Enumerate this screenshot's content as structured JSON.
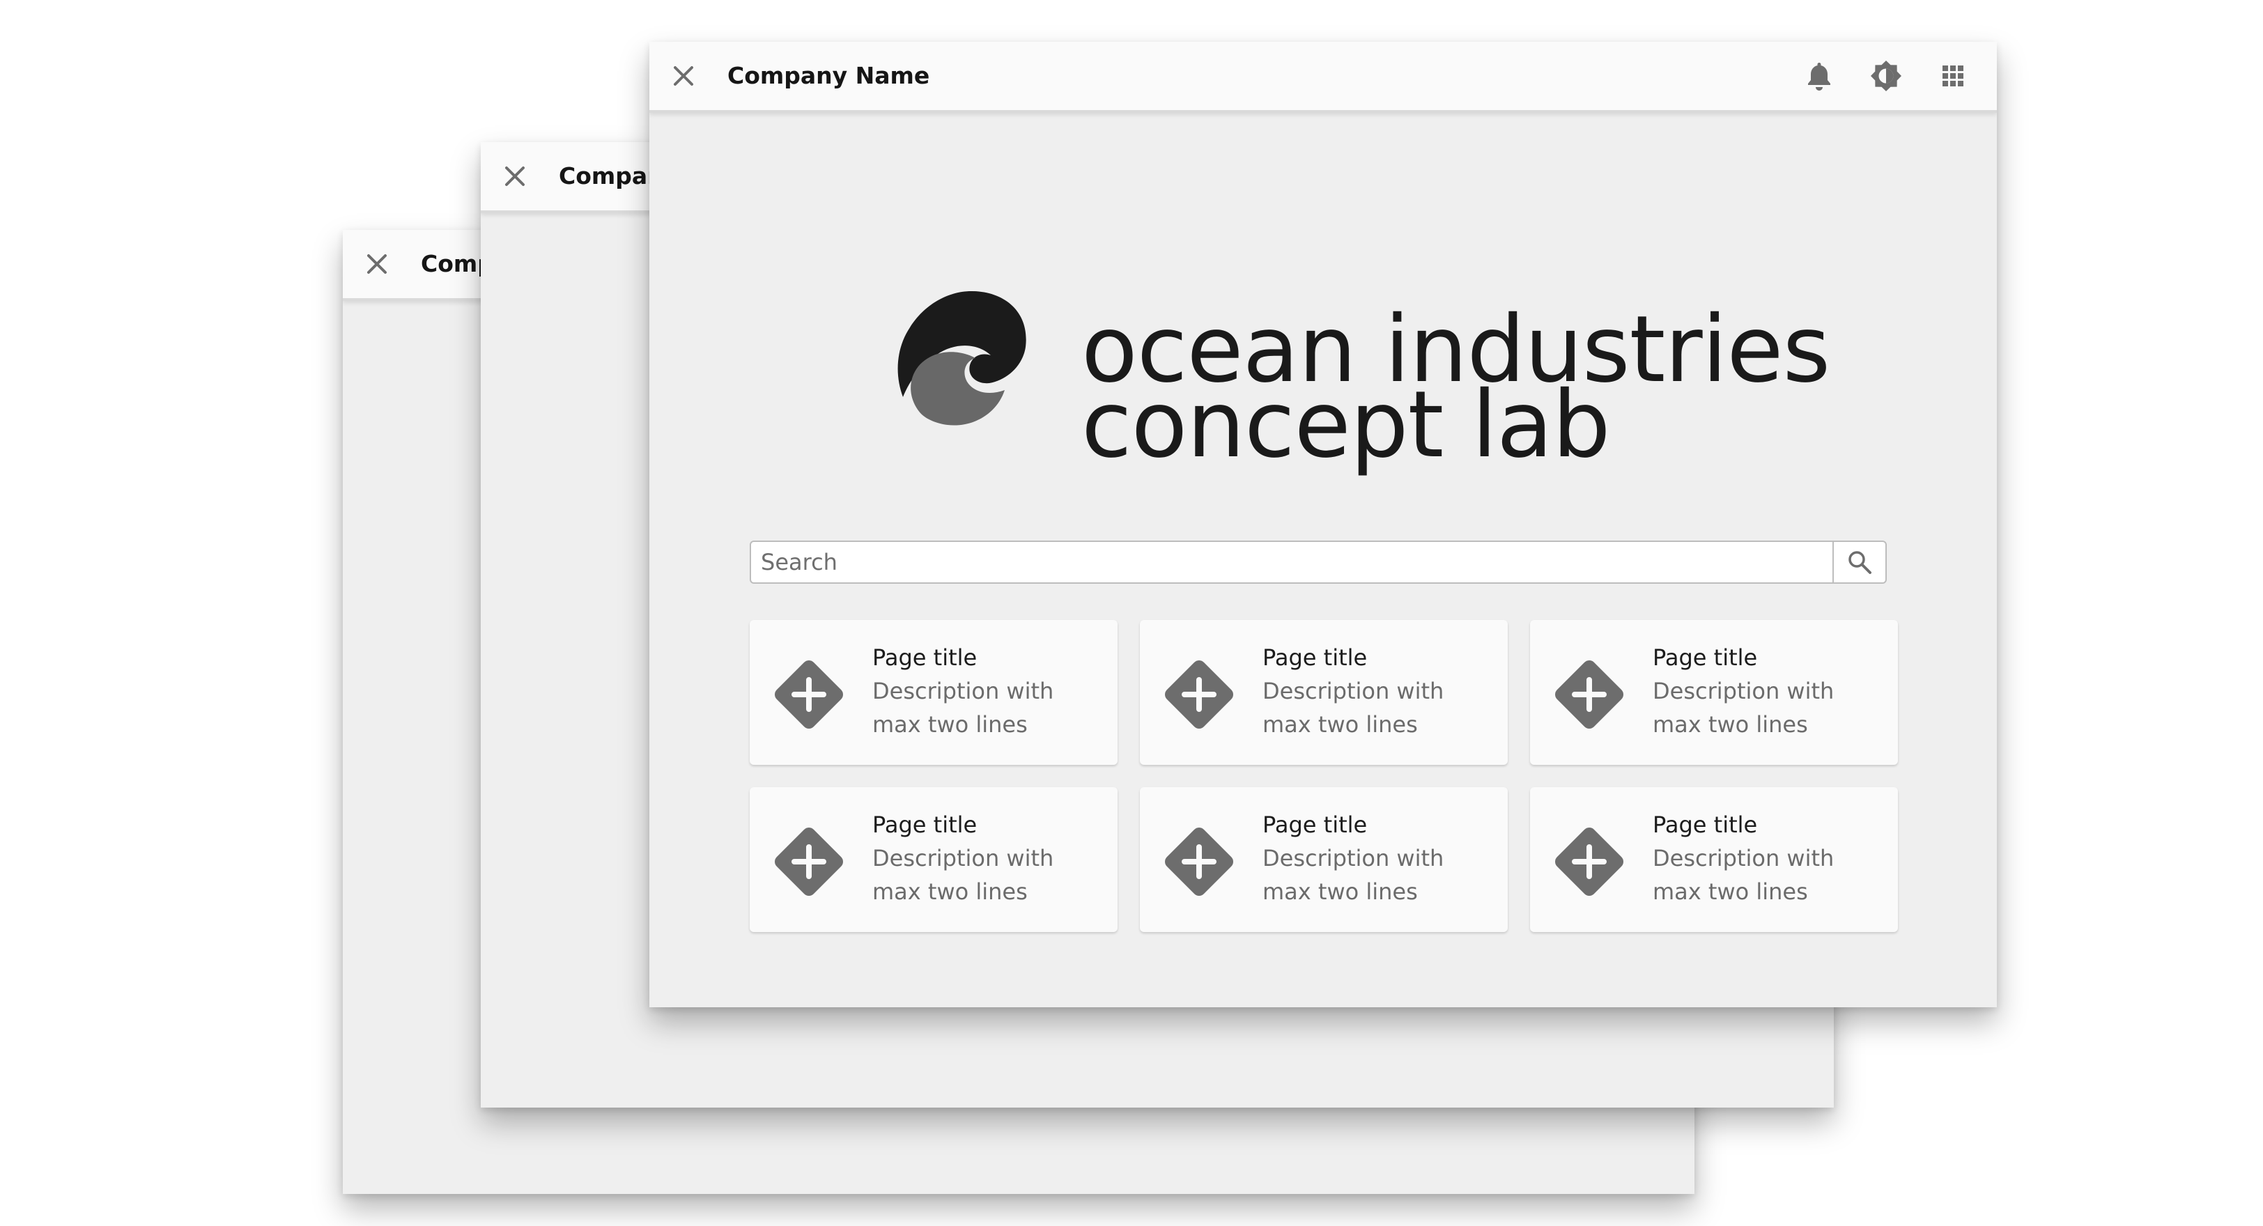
{
  "windows": {
    "back": {
      "title": "Comp"
    },
    "middle": {
      "title": "Compan"
    },
    "front": {
      "title": "Company Name"
    }
  },
  "header_icons": [
    "close-icon",
    "bell-icon",
    "brightness-icon",
    "apps-grid-icon"
  ],
  "brand": {
    "line1": "ocean industries",
    "line2": "concept lab",
    "logo": "wave-logo"
  },
  "search": {
    "placeholder": "Search",
    "value": "",
    "icon": "search-icon"
  },
  "tiles": [
    {
      "title": "Page title",
      "description": "Description with max two lines",
      "icon": "add-diamond-icon"
    },
    {
      "title": "Page title",
      "description": "Description with max two lines",
      "icon": "add-diamond-icon"
    },
    {
      "title": "Page title",
      "description": "Description with max two lines",
      "icon": "add-diamond-icon"
    },
    {
      "title": "Page title",
      "description": "Description with max two lines",
      "icon": "add-diamond-icon"
    },
    {
      "title": "Page title",
      "description": "Description with max two lines",
      "icon": "add-diamond-icon"
    },
    {
      "title": "Page title",
      "description": "Description with max two lines",
      "icon": "add-diamond-icon"
    }
  ],
  "colors": {
    "window_bg": "#efefef",
    "titlebar_bg": "#fafafa",
    "icon_gray": "#6d6d6d",
    "text_dark": "#1a1a1a",
    "text_muted": "#6b6b6b"
  }
}
